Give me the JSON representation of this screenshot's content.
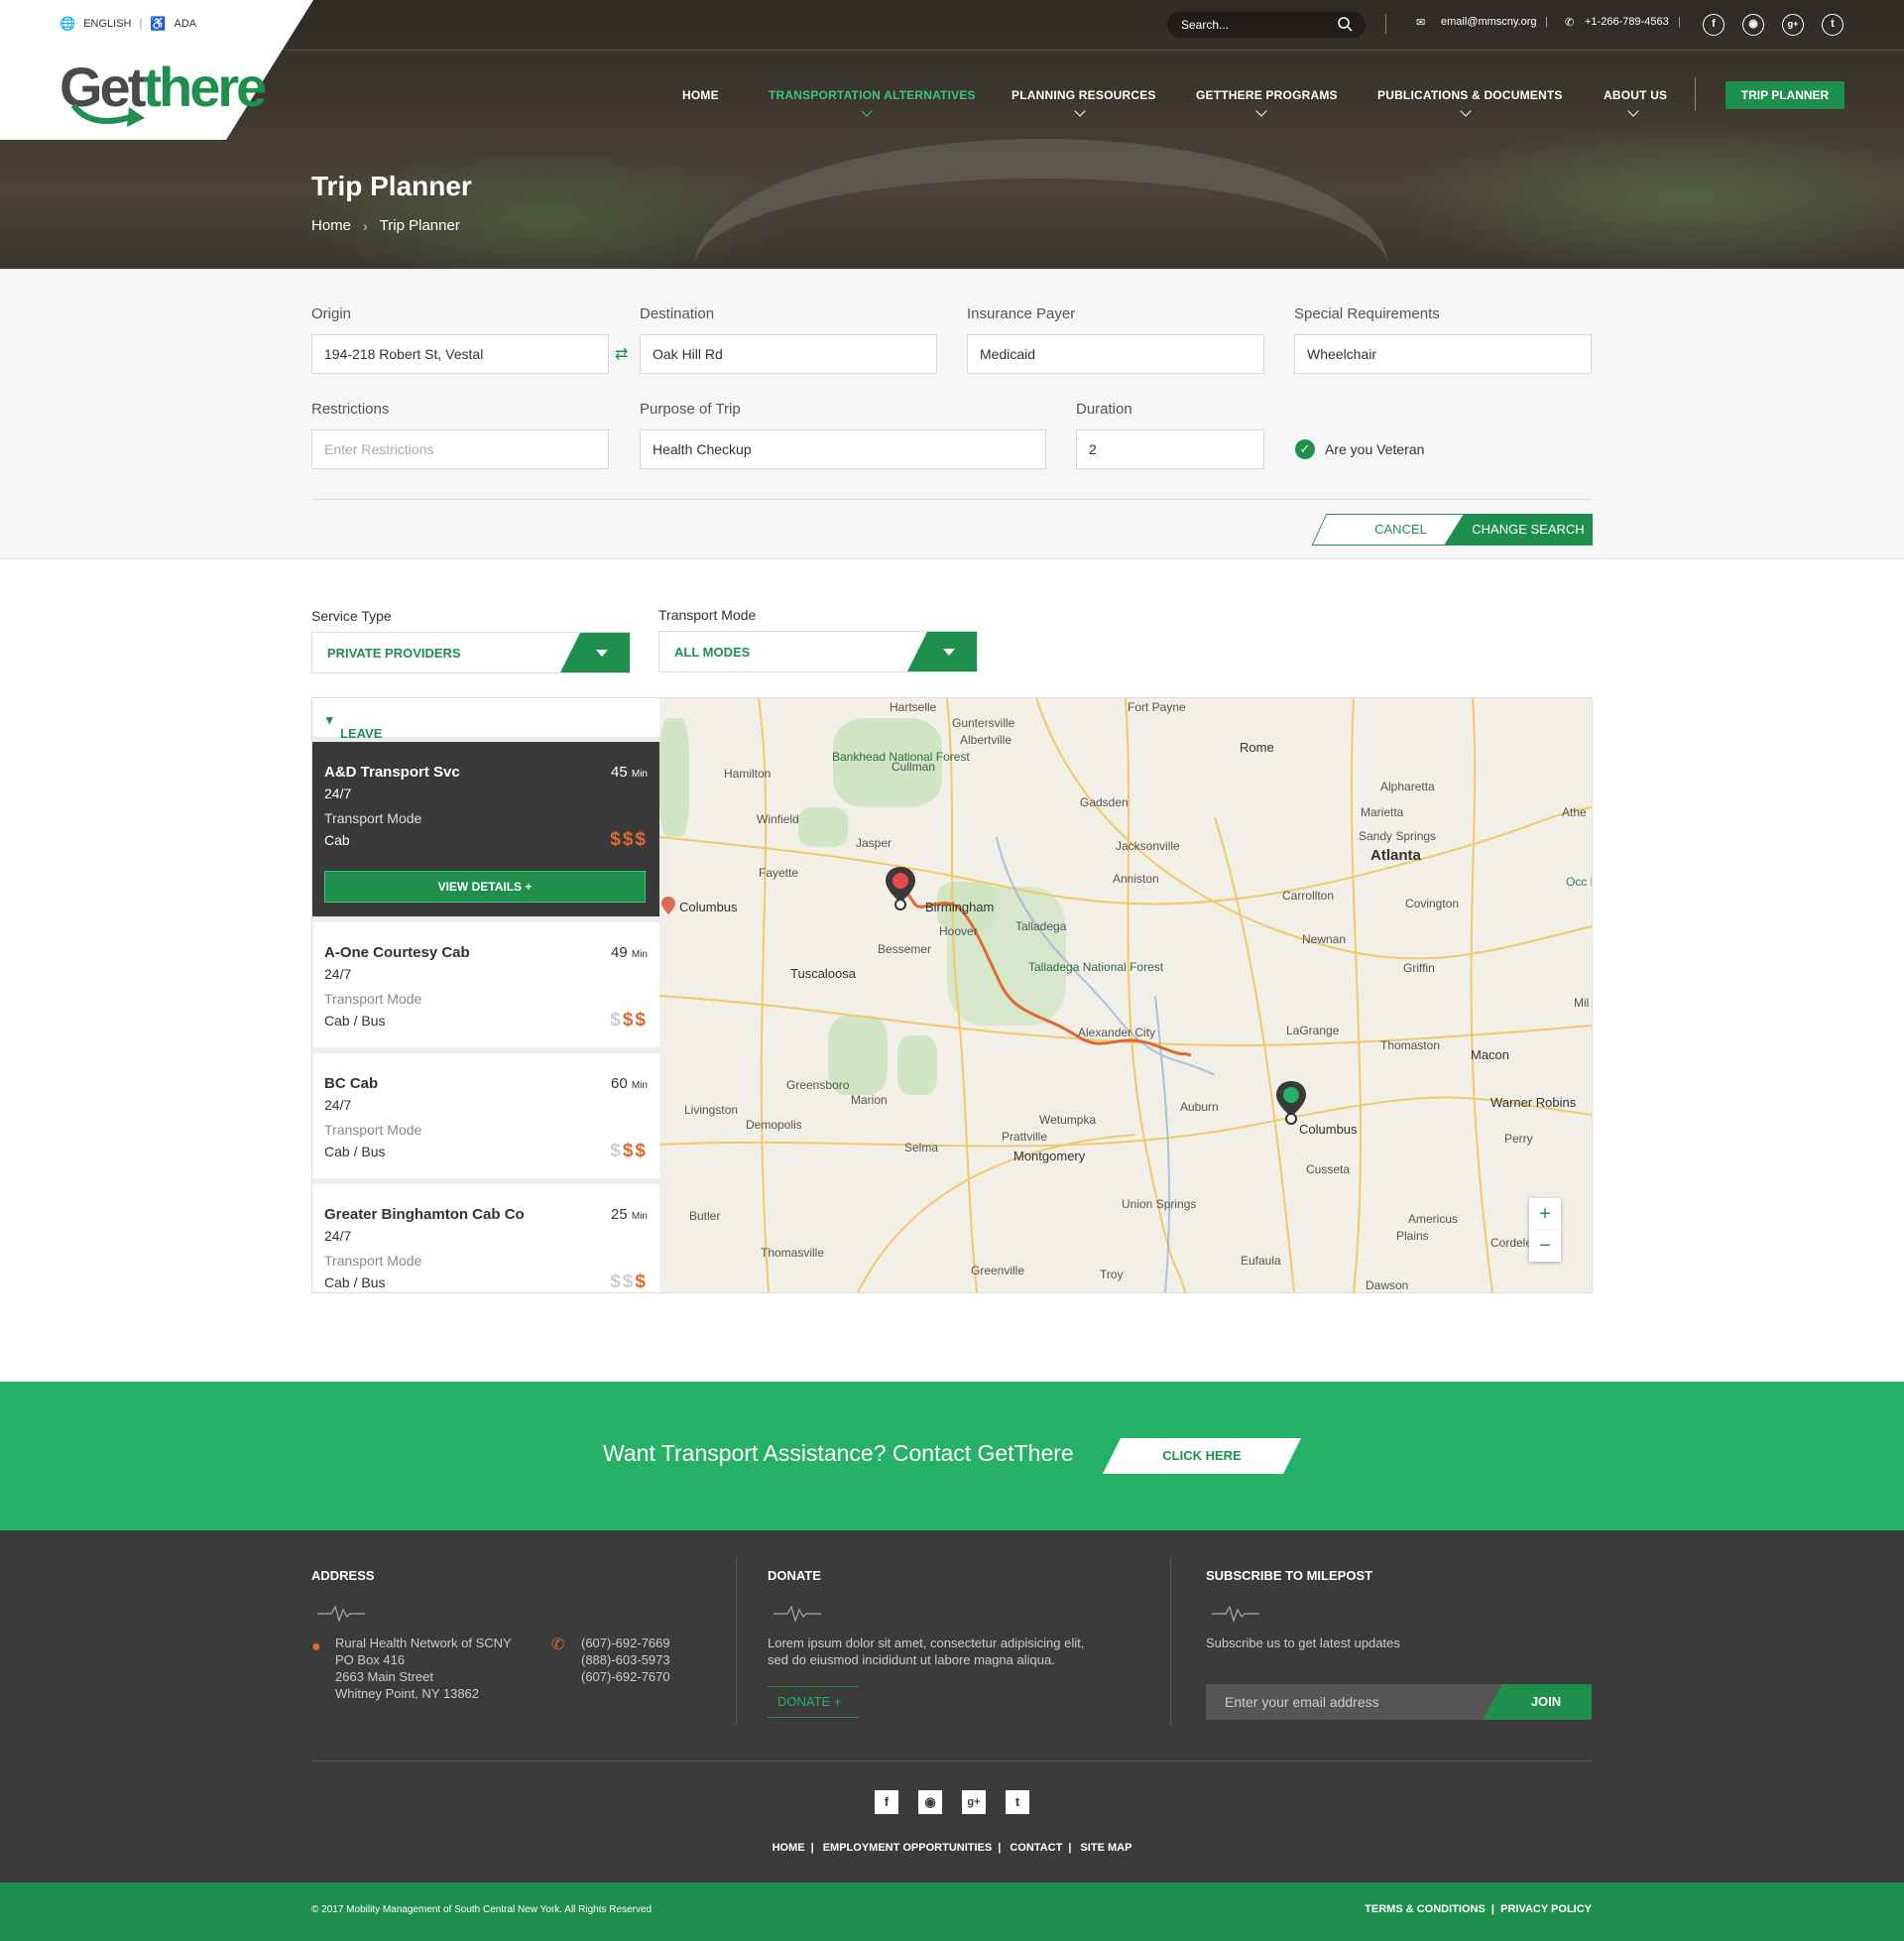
{
  "topbar": {
    "language": "ENGLISH",
    "ada": "ADA",
    "search_placeholder": "Search...",
    "email": "email@mmscny.org",
    "phone": "+1-266-789-4563"
  },
  "brand": {
    "logo_part1": "Get",
    "logo_part2": "there"
  },
  "nav": {
    "items": [
      {
        "label": "HOME"
      },
      {
        "label": "TRANSPORTATION ALTERNATIVES"
      },
      {
        "label": "PLANNING RESOURCES"
      },
      {
        "label": "GETTHERE PROGRAMS"
      },
      {
        "label": "PUBLICATIONS & DOCUMENTS"
      },
      {
        "label": "ABOUT US"
      }
    ],
    "cta": "TRIP PLANNER"
  },
  "hero": {
    "title": "Trip Planner",
    "breadcrumb_home": "Home",
    "breadcrumb_current": "Trip Planner"
  },
  "form": {
    "origin_label": "Origin",
    "origin_value": "194-218 Robert St, Vestal",
    "destination_label": "Destination",
    "destination_value": "Oak Hill Rd",
    "insurance_label": "Insurance Payer",
    "insurance_value": "Medicaid",
    "special_label": "Special Requirements",
    "special_value": "Wheelchair",
    "restrictions_label": "Restrictions",
    "restrictions_placeholder": "Enter Restrictions",
    "purpose_label": "Purpose of Trip",
    "purpose_value": "Health Checkup",
    "duration_label": "Duration",
    "duration_value": "2",
    "veteran_label": "Are you Veteran",
    "cancel": "CANCEL",
    "change": "CHANGE SEARCH"
  },
  "filters": {
    "service_label": "Service Type",
    "service_value": "PRIVATE PROVIDERS",
    "mode_label": "Transport Mode",
    "mode_value": "ALL MODES"
  },
  "results": {
    "leave": "LEAVE NOW",
    "view_details": "VIEW DETAILS +",
    "mode_label": "Transport Mode",
    "min_unit": "Min",
    "providers": [
      {
        "name": "A&D Transport Svc",
        "hours": "24/7",
        "mode": "Cab",
        "minutes": "45",
        "cost_level": 3
      },
      {
        "name": "A-One Courtesy Cab",
        "hours": "24/7",
        "mode": "Cab / Bus",
        "minutes": "49",
        "cost_level": 2
      },
      {
        "name": "BC Cab",
        "hours": "24/7",
        "mode": "Cab / Bus",
        "minutes": "60",
        "cost_level": 2
      },
      {
        "name": "Greater Binghamton Cab Co",
        "hours": "24/7",
        "mode": "Cab / Bus",
        "minutes": "25",
        "cost_level": 1
      }
    ]
  },
  "map": {
    "cities": [
      "Hartselle",
      "Guntersville",
      "Albertville",
      "Fort Payne",
      "Rome",
      "Cullman",
      "Hamilton",
      "Winfield",
      "Jasper",
      "Gadsden",
      "Jacksonville",
      "Alpharetta",
      "Marietta",
      "Sandy Springs",
      "Atlanta",
      "Fayette",
      "Anniston",
      "Carrollton",
      "Birmingham",
      "Hoover",
      "Talladega",
      "Bessemer",
      "Newnan",
      "Tuscaloosa",
      "Griffin",
      "Alexander City",
      "LaGrange",
      "Thomaston",
      "Macon",
      "Greensboro",
      "Marion",
      "Livingston",
      "Demopolis",
      "Auburn",
      "Columbus",
      "Warner Robins",
      "Prattville",
      "Wetumpka",
      "Selma",
      "Montgomery",
      "Cusseta",
      "Perry",
      "Union Springs",
      "Americus",
      "Butler",
      "Thomasville",
      "Greenville",
      "Troy",
      "Eufaula",
      "Plains",
      "Cordele",
      "Dawson",
      "Covington",
      "Athe",
      "Mil",
      "Occ Nationa"
    ],
    "forests": [
      "Bankhead National Forest",
      "Talladega National Forest"
    ],
    "left_city": "Columbus",
    "zoom_in": "+",
    "zoom_out": "−"
  },
  "cta": {
    "text": "Want Transport Assistance? Contact GetThere",
    "button": "CLICK HERE"
  },
  "footer": {
    "address_title": "ADDRESS",
    "address_lines": [
      "Rural Health Network of SCNY",
      "PO Box 416",
      "2663 Main Street",
      "Whitney Point, NY 13862"
    ],
    "phones": [
      "(607)-692-7669",
      "(888)-603-5973",
      "(607)-692-7670"
    ],
    "donate_title": "DONATE",
    "donate_text": "Lorem ipsum dolor sit amet, consectetur adipisicing elit, sed do eiusmod incididunt ut labore magna aliqua.",
    "donate_button": "DONATE",
    "subscribe_title": "SUBSCRIBE TO MILEPOST",
    "subscribe_text": "Subscribe us to get latest updates",
    "email_placeholder": "Enter your email address",
    "join": "JOIN",
    "links": [
      "HOME",
      "EMPLOYMENT OPPORTUNITIES",
      "CONTACT",
      "SITE MAP"
    ],
    "copyright": "© 2017 Mobility Management of South Central New York. All Rights Reserved",
    "terms": "TERMS & CONDITIONS",
    "privacy": "PRIVACY POLICY"
  },
  "colors": {
    "brand_green": "#1f8f4e",
    "cta_green": "#27b067",
    "cost_orange": "#e06a2d",
    "dark": "#3b3b3b"
  }
}
